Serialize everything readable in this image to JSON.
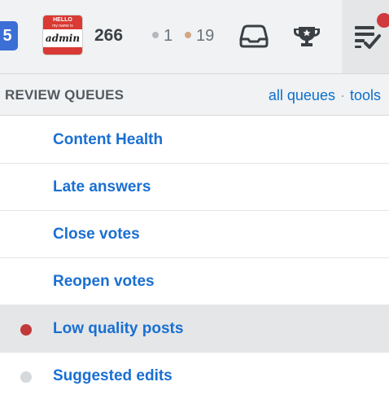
{
  "topbar": {
    "site_icon_letter": "5",
    "avatar": {
      "band_top": "HELLO",
      "band_sub": "my name is",
      "name": "admin"
    },
    "reputation": "266",
    "badges": {
      "silver": {
        "count": "1",
        "color": "#b4b8bc"
      },
      "bronze": {
        "count": "19",
        "color": "#d1a684"
      }
    },
    "icons": [
      "inbox-icon",
      "trophy-icon",
      "review-queue-icon"
    ],
    "notification_color": "#d0393e"
  },
  "dropdown": {
    "title": "REVIEW QUEUES",
    "links": {
      "all_queues": "all queues",
      "separator": "·",
      "tools": "tools"
    },
    "queues": [
      {
        "label": "Content Health",
        "status": "none"
      },
      {
        "label": "Late answers",
        "status": "none"
      },
      {
        "label": "Close votes",
        "status": "none"
      },
      {
        "label": "Reopen votes",
        "status": "none"
      },
      {
        "label": "Low quality posts",
        "status": "red",
        "active": true
      },
      {
        "label": "Suggested edits",
        "status": "gray"
      }
    ],
    "status_colors": {
      "red": "#c2393a",
      "gray": "#d6d9dc"
    }
  }
}
